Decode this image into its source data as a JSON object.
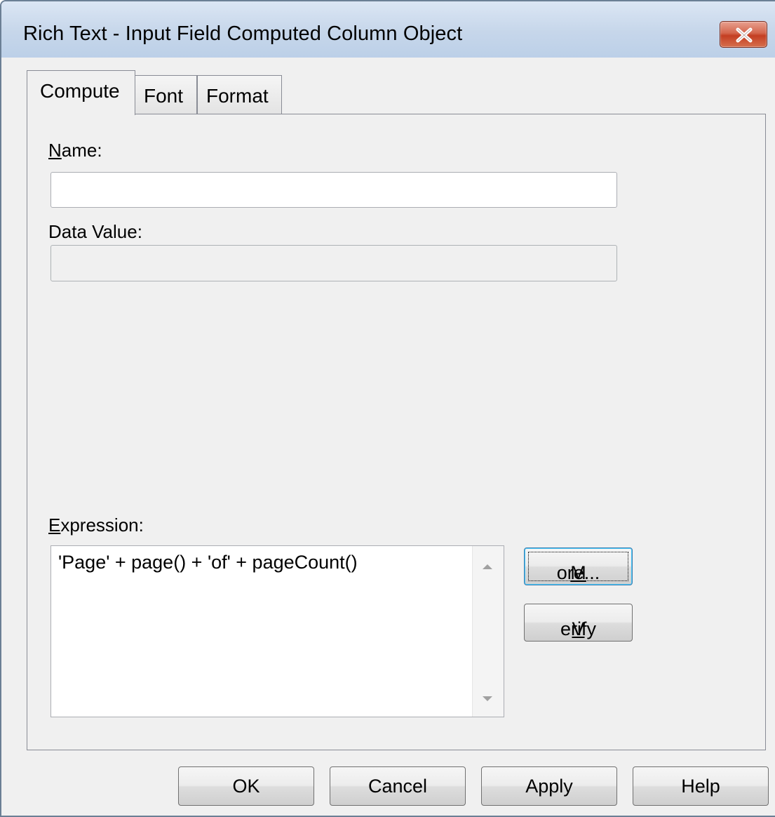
{
  "window": {
    "title": "Rich Text - Input Field Computed Column Object"
  },
  "tabs": [
    {
      "label": "Compute",
      "selected": true
    },
    {
      "label": "Font",
      "selected": false
    },
    {
      "label": "Format",
      "selected": false
    }
  ],
  "compute": {
    "name_label_hotkey": "N",
    "name_label_rest": "ame:",
    "name_value": "",
    "data_value_label": "Data Value:",
    "data_value": "",
    "expression_label_hotkey": "E",
    "expression_label_rest": "xpression:",
    "expression_value": "'Page' + page() + 'of' + pageCount()",
    "more_hotkey": "M",
    "more_rest": "ore...",
    "verify_hotkey": "V",
    "verify_rest": "erify"
  },
  "footer": {
    "ok": "OK",
    "cancel": "Cancel",
    "apply": "Apply",
    "help": "Help"
  },
  "icons": {
    "close": "close-icon",
    "scroll_up": "scroll-up-arrow-icon",
    "scroll_down": "scroll-down-arrow-icon"
  },
  "colors": {
    "close_button": "#c43e22",
    "title_bar": "#c6d6ea",
    "dialog_background": "#f0f0f0",
    "focus_border": "#3c7fb1"
  }
}
